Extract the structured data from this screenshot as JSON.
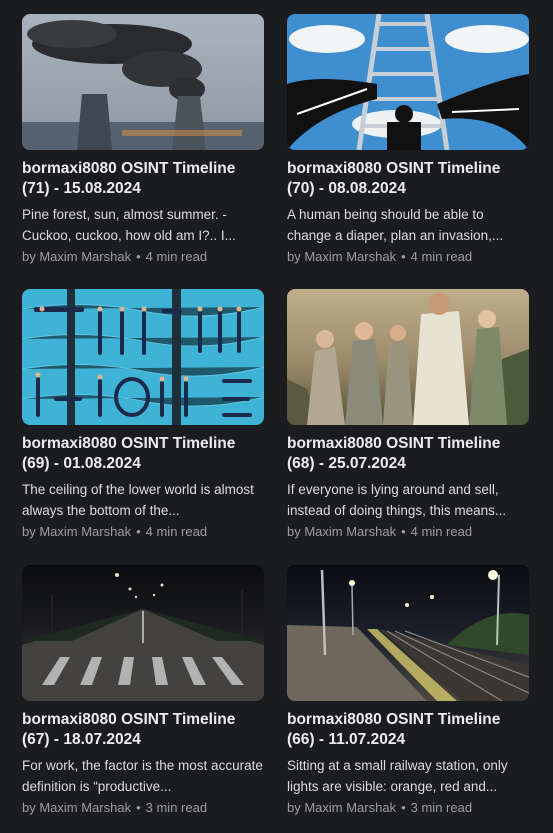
{
  "posts": [
    {
      "title": "bormaxi8080 OSINT Timeline (71) - 15.08.2024",
      "excerpt": "Pine forest, sun, almost summer. - Cuckoo, cuckoo, how old am I?.. I...",
      "author": "by Maxim Marshak",
      "separator": "•",
      "read_time": "4 min read",
      "image": "smokestacks-image"
    },
    {
      "title": "bormaxi8080 OSINT Timeline (70) - 08.08.2024",
      "excerpt": "A human being should be able to change a diaper, plan an invasion,...",
      "author": "by Maxim Marshak",
      "separator": "•",
      "read_time": "4 min read",
      "image": "ladder-illustration"
    },
    {
      "title": "bormaxi8080 OSINT Timeline (69) - 01.08.2024",
      "excerpt": "The ceiling of the lower world is almost always the bottom of the...",
      "author": "by Maxim Marshak",
      "separator": "•",
      "read_time": "4 min read",
      "image": "swimmers-pool-image"
    },
    {
      "title": "bormaxi8080 OSINT Timeline (68) - 25.07.2024",
      "excerpt": "If everyone is lying around and sell, instead of doing things, this means...",
      "author": "by Maxim Marshak",
      "separator": "•",
      "read_time": "4 min read",
      "image": "robed-figures-image"
    },
    {
      "title": "bormaxi8080 OSINT Timeline (67) - 18.07.2024",
      "excerpt": "For work, the factor is the most accurate definition is “productive...",
      "author": "by Maxim Marshak",
      "separator": "•",
      "read_time": "3 min read",
      "image": "night-road-image"
    },
    {
      "title": "bormaxi8080 OSINT Timeline (66) - 11.07.2024",
      "excerpt": "Sitting at a small railway station, only lights are visible: orange, red and...",
      "author": "by Maxim Marshak",
      "separator": "•",
      "read_time": "3 min read",
      "image": "railway-station-image"
    }
  ],
  "colors": {
    "background": "#1b1c20",
    "title": "#ececee",
    "excerpt": "#dcdcde",
    "meta": "#9d9da3"
  }
}
